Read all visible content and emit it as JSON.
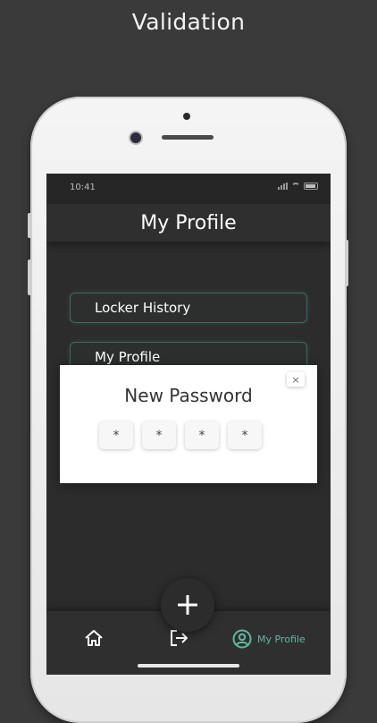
{
  "caption": "Validation",
  "status_bar": {
    "time": "10:41"
  },
  "header": {
    "title": "My Profile"
  },
  "menu": {
    "items": [
      {
        "label": "Locker History"
      },
      {
        "label": "My Profile"
      }
    ]
  },
  "modal": {
    "title": "New Password",
    "close_glyph": "×",
    "pins": [
      "*",
      "*",
      "*",
      "*"
    ]
  },
  "fab": {
    "glyph": "+"
  },
  "tabbar": {
    "profile_label": "My Profile"
  },
  "colors": {
    "accent": "#5fb8a0",
    "screen_bg": "#2c2c2c",
    "outer_bg": "#3a3a3a"
  },
  "icons": {
    "home": "home-icon",
    "logout": "logout-icon",
    "profile": "user-circle-icon",
    "add": "plus-icon",
    "close": "close-icon"
  }
}
